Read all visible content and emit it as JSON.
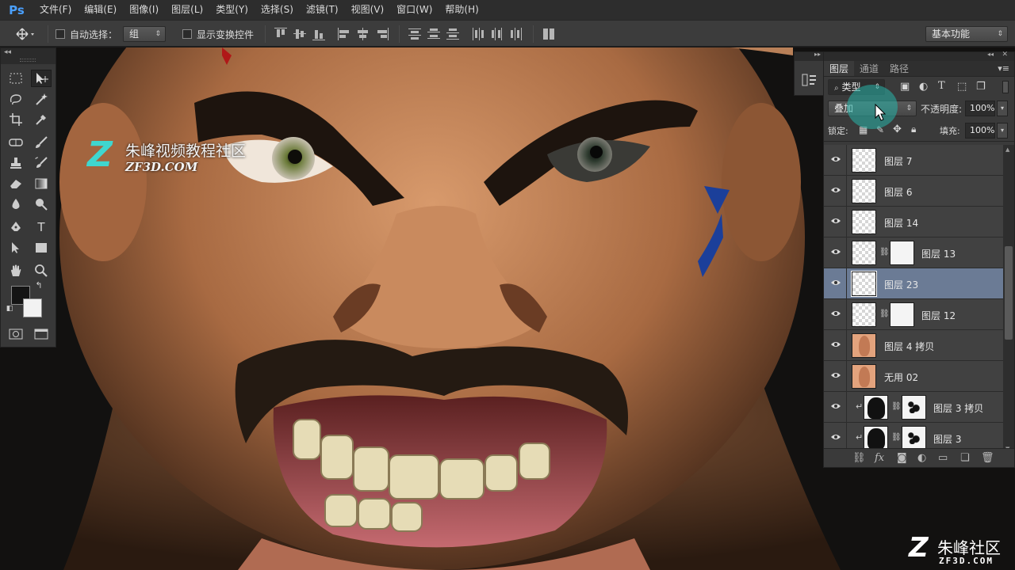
{
  "app": {
    "logo": "Ps"
  },
  "menu": [
    "文件(F)",
    "编辑(E)",
    "图像(I)",
    "图层(L)",
    "类型(Y)",
    "选择(S)",
    "滤镜(T)",
    "视图(V)",
    "窗口(W)",
    "帮助(H)"
  ],
  "options_bar": {
    "auto_select_label": "自动选择：",
    "auto_select_value": "组",
    "transform_controls_label": "显示变换控件",
    "workspace": "基本功能"
  },
  "watermark": {
    "title": "朱峰视频教程社区",
    "url": "ZF3D.COM",
    "corner_title": "朱峰社区",
    "corner_url": "ZF3D.COM",
    "z_glyph": "Z"
  },
  "tools": {
    "foreground_color": "#141414",
    "background_color": "#f2f2f2",
    "items": [
      "marquee-icon",
      "move-icon",
      "lasso-icon",
      "magic-wand-icon",
      "crop-icon",
      "eyedropper-icon",
      "healing-icon",
      "brush-icon",
      "stamp-icon",
      "history-brush-icon",
      "eraser-icon",
      "gradient-icon",
      "blur-icon",
      "dodge-icon",
      "pen-icon",
      "type-icon",
      "path-select-icon",
      "rectangle-icon",
      "hand-icon",
      "zoom-icon"
    ],
    "type_glyph": "T"
  },
  "layers_panel": {
    "tabs": [
      "图层",
      "通道",
      "路径"
    ],
    "filter_kind": "类型",
    "blend_mode": "叠加",
    "opacity_label": "不透明度:",
    "opacity_value": "100%",
    "lock_label": "锁定:",
    "fill_label": "填充:",
    "fill_value": "100%",
    "footer_fx": "fx",
    "layers": [
      {
        "name": "图层 7",
        "thumb": "transparent",
        "mask": false,
        "visible": true,
        "selected": false,
        "clipped": false
      },
      {
        "name": "图层 6",
        "thumb": "transparent",
        "mask": false,
        "visible": true,
        "selected": false,
        "clipped": false
      },
      {
        "name": "图层 14",
        "thumb": "transparent",
        "mask": false,
        "visible": true,
        "selected": false,
        "clipped": false
      },
      {
        "name": "图层 13",
        "thumb": "transparent",
        "mask": true,
        "visible": true,
        "selected": false,
        "clipped": false
      },
      {
        "name": "图层 23",
        "thumb": "transparent",
        "mask": false,
        "visible": true,
        "selected": true,
        "clipped": false
      },
      {
        "name": "图层 12",
        "thumb": "transparent",
        "mask": true,
        "visible": true,
        "selected": false,
        "clipped": false
      },
      {
        "name": "图层 4 拷贝",
        "thumb": "skin",
        "mask": false,
        "visible": true,
        "selected": false,
        "clipped": false
      },
      {
        "name": "无用 02",
        "thumb": "skin",
        "mask": false,
        "visible": true,
        "selected": false,
        "clipped": false
      },
      {
        "name": "图层 3 拷贝",
        "thumb": "silhouette",
        "mask": true,
        "visible": true,
        "selected": false,
        "clipped": true
      },
      {
        "name": "图层 3",
        "thumb": "silhouette",
        "mask": true,
        "visible": true,
        "selected": false,
        "clipped": true
      }
    ]
  }
}
